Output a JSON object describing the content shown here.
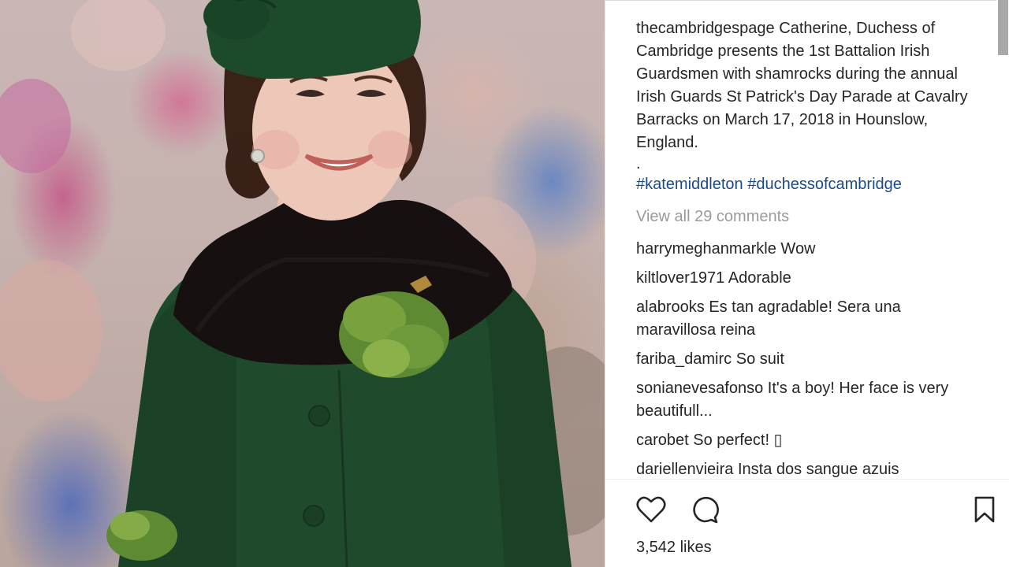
{
  "post": {
    "username": "thecambridgespage",
    "caption": "Catherine, Duchess of Cambridge presents the 1st Battalion Irish Guardsmen with shamrocks during the annual Irish Guards St Patrick's Day Parade at Cavalry Barracks on March 17, 2018 in Hounslow, England.",
    "dot": ".",
    "hashtags": [
      "#katemiddleton",
      "#duchessofcambridge"
    ],
    "view_all": "View all 29 comments",
    "likes": "3,542 likes"
  },
  "comments": [
    {
      "user": "harrymeghanmarkle",
      "text": "Wow"
    },
    {
      "user": "kiltlover1971",
      "text": "Adorable"
    },
    {
      "user": "alabrooks",
      "text": "Es tan agradable! Sera una maravillosa reina"
    },
    {
      "user": "fariba_damirc",
      "text": "So suit"
    },
    {
      "user": "sonianevesafonso",
      "text": "It's a boy! Her face is very beautifull..."
    },
    {
      "user": "carobet",
      "text": "So perfect! ▯"
    },
    {
      "user": "dariellenvieira",
      "text": "Insta dos sangue azuis"
    }
  ],
  "icons": {
    "like": "heart-icon",
    "comment": "comment-bubble-icon",
    "save": "bookmark-icon"
  },
  "colors": {
    "hashtag": "#1a4a8a",
    "muted": "#9a9a9a",
    "text": "#262626",
    "coat_green": "#1f4a2c"
  }
}
